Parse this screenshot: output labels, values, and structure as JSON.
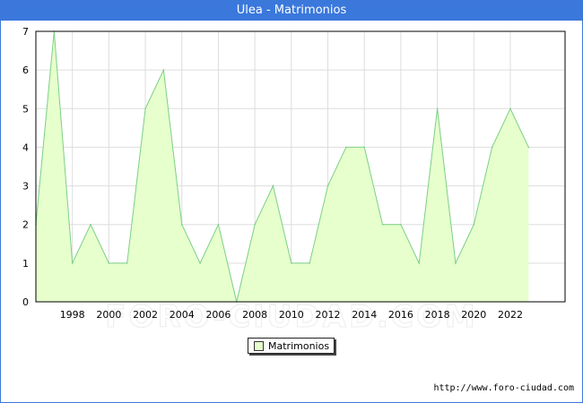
{
  "window": {
    "title": "Ulea - Matrimonios"
  },
  "footer": {
    "source_url": "http://www.foro-ciudad.com",
    "watermark": "FORO-CIUDAD.COM"
  },
  "colors": {
    "title_bar": "#3a78dc",
    "fill": "#e6ffcc",
    "line": "#7ccf88",
    "grid": "#dddddd"
  },
  "chart_data": {
    "type": "area",
    "title": "Ulea - Matrimonios",
    "xlabel": "",
    "ylabel": "",
    "x": [
      1996,
      1997,
      1998,
      1999,
      2000,
      2001,
      2002,
      2003,
      2004,
      2005,
      2006,
      2007,
      2008,
      2009,
      2010,
      2011,
      2012,
      2013,
      2014,
      2015,
      2016,
      2017,
      2018,
      2019,
      2020,
      2021,
      2022,
      2023
    ],
    "series": [
      {
        "name": "Matrimonios",
        "values": [
          2,
          7,
          1,
          2,
          1,
          1,
          5,
          6,
          2,
          1,
          2,
          0,
          2,
          3,
          1,
          1,
          3,
          4,
          4,
          2,
          2,
          1,
          5,
          1,
          2,
          4,
          5,
          4
        ]
      }
    ],
    "x_ticks": [
      "1998",
      "2000",
      "2002",
      "2004",
      "2006",
      "2008",
      "2010",
      "2012",
      "2014",
      "2016",
      "2018",
      "2020",
      "2022"
    ],
    "y_ticks": [
      "0",
      "1",
      "2",
      "3",
      "4",
      "5",
      "6",
      "7"
    ],
    "xlim": [
      1996,
      2025
    ],
    "ylim": [
      0,
      7
    ],
    "grid": true,
    "legend": {
      "position": "bottom-center",
      "label": "Matrimonios"
    }
  }
}
